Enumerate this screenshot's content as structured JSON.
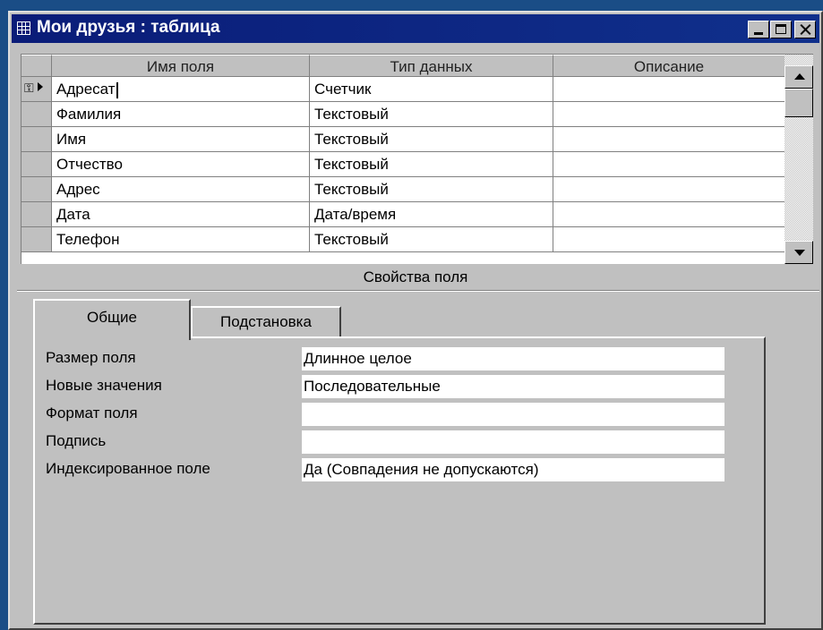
{
  "window": {
    "title": "Мои друзья : таблица",
    "icon": "table-icon"
  },
  "grid": {
    "columns": [
      "Имя поля",
      "Тип данных",
      "Описание"
    ],
    "rows": [
      {
        "name": "Адресат",
        "type": "Счетчик",
        "desc": ""
      },
      {
        "name": "Фамилия",
        "type": "Текстовый",
        "desc": ""
      },
      {
        "name": "Имя",
        "type": "Текстовый",
        "desc": ""
      },
      {
        "name": "Отчество",
        "type": "Текстовый",
        "desc": ""
      },
      {
        "name": "Адрес",
        "type": "Текстовый",
        "desc": ""
      },
      {
        "name": "Дата",
        "type": "Дата/время",
        "desc": ""
      },
      {
        "name": "Телефон",
        "type": "Текстовый",
        "desc": ""
      }
    ]
  },
  "properties": {
    "title": "Свойства поля",
    "tabs": [
      "Общие",
      "Подстановка"
    ],
    "items": [
      {
        "label": "Размер поля",
        "value": "Длинное целое"
      },
      {
        "label": "Новые значения",
        "value": "Последовательные"
      },
      {
        "label": "Формат поля",
        "value": ""
      },
      {
        "label": "Подпись",
        "value": ""
      },
      {
        "label": "Индексированное поле",
        "value": "Да (Совпадения не допускаются)"
      }
    ]
  },
  "colors": {
    "desktop": "#1a4d86",
    "titlebar": "#0a1c78",
    "face": "#c0c0c0"
  }
}
